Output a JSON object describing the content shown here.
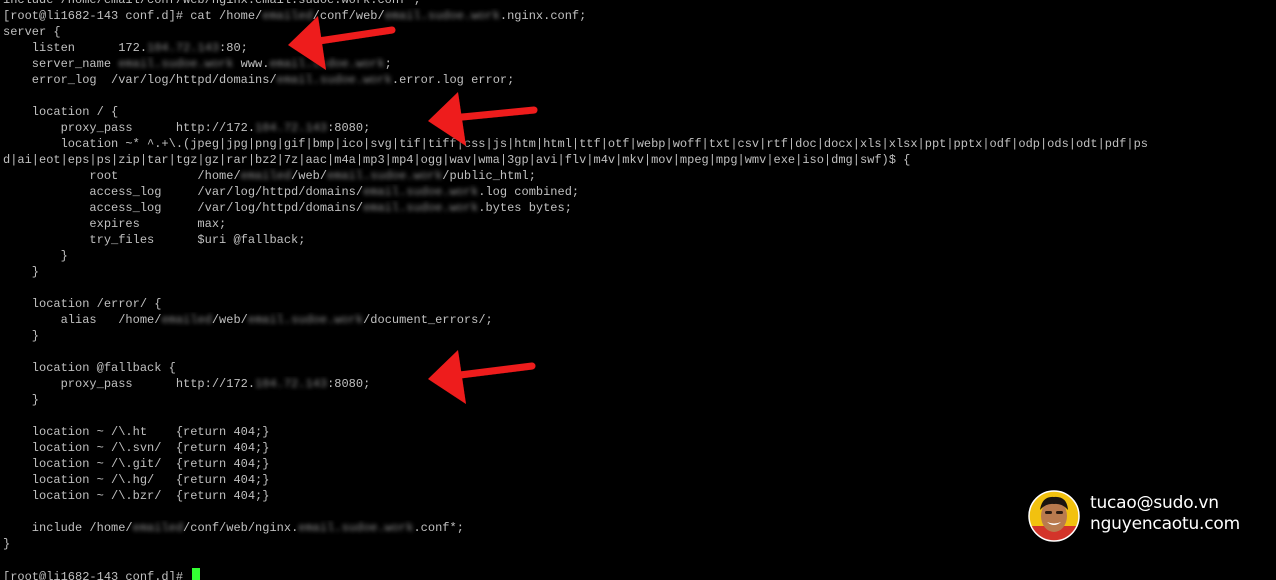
{
  "terminal": {
    "lines": [
      [
        {
          "t": "include /home/email/conf/web/nginx.email.sudoe.work.conf*;",
          "b": false
        }
      ],
      [
        {
          "t": "[root@li1682-143 conf.d]# cat /home/",
          "b": false
        },
        {
          "t": "emailed",
          "b": true
        },
        {
          "t": "/conf/web/",
          "b": false
        },
        {
          "t": "email.sudoe.work",
          "b": true
        },
        {
          "t": ".nginx.conf;",
          "b": false
        }
      ],
      [
        {
          "t": "server {",
          "b": false
        }
      ],
      [
        {
          "t": "    listen      172.",
          "b": false
        },
        {
          "t": "104.72.143",
          "b": true
        },
        {
          "t": ":80;",
          "b": false
        }
      ],
      [
        {
          "t": "    server_name ",
          "b": false
        },
        {
          "t": "email.sudoe.work",
          "b": true
        },
        {
          "t": " www.",
          "b": false
        },
        {
          "t": "email.sudoe.work",
          "b": true
        },
        {
          "t": ";",
          "b": false
        }
      ],
      [
        {
          "t": "    error_log  /var/log/httpd/domains/",
          "b": false
        },
        {
          "t": "email.sudoe.work",
          "b": true
        },
        {
          "t": ".error.log error;",
          "b": false
        }
      ],
      [
        {
          "t": "",
          "b": false
        }
      ],
      [
        {
          "t": "    location / {",
          "b": false
        }
      ],
      [
        {
          "t": "        proxy_pass      http://172.",
          "b": false
        },
        {
          "t": "104.72.143",
          "b": true
        },
        {
          "t": ":8080;",
          "b": false
        }
      ],
      [
        {
          "t": "        location ~* ^.+\\.(jpeg|jpg|png|gif|bmp|ico|svg|tif|tiff|css|js|htm|html|ttf|otf|webp|woff|txt|csv|rtf|doc|docx|xls|xlsx|ppt|pptx|odf|odp|ods|odt|pdf|ps",
          "b": false
        }
      ],
      [
        {
          "t": "d|ai|eot|eps|ps|zip|tar|tgz|gz|rar|bz2|7z|aac|m4a|mp3|mp4|ogg|wav|wma|3gp|avi|flv|m4v|mkv|mov|mpeg|mpg|wmv|exe|iso|dmg|swf)$ {",
          "b": false
        }
      ],
      [
        {
          "t": "            root           /home/",
          "b": false
        },
        {
          "t": "emailed",
          "b": true
        },
        {
          "t": "/web/",
          "b": false
        },
        {
          "t": "email.sudoe.work",
          "b": true
        },
        {
          "t": "/public_html;",
          "b": false
        }
      ],
      [
        {
          "t": "            access_log     /var/log/httpd/domains/",
          "b": false
        },
        {
          "t": "email.sudoe.work",
          "b": true
        },
        {
          "t": ".log combined;",
          "b": false
        }
      ],
      [
        {
          "t": "            access_log     /var/log/httpd/domains/",
          "b": false
        },
        {
          "t": "email.sudoe.work",
          "b": true
        },
        {
          "t": ".bytes bytes;",
          "b": false
        }
      ],
      [
        {
          "t": "            expires        max;",
          "b": false
        }
      ],
      [
        {
          "t": "            try_files      $uri @fallback;",
          "b": false
        }
      ],
      [
        {
          "t": "        }",
          "b": false
        }
      ],
      [
        {
          "t": "    }",
          "b": false
        }
      ],
      [
        {
          "t": "",
          "b": false
        }
      ],
      [
        {
          "t": "    location /error/ {",
          "b": false
        }
      ],
      [
        {
          "t": "        alias   /home/",
          "b": false
        },
        {
          "t": "emailed",
          "b": true
        },
        {
          "t": "/web/",
          "b": false
        },
        {
          "t": "email.sudoe.work",
          "b": true
        },
        {
          "t": "/document_errors/;",
          "b": false
        }
      ],
      [
        {
          "t": "    }",
          "b": false
        }
      ],
      [
        {
          "t": "",
          "b": false
        }
      ],
      [
        {
          "t": "    location @fallback {",
          "b": false
        }
      ],
      [
        {
          "t": "        proxy_pass      http://172.",
          "b": false
        },
        {
          "t": "104.72.143",
          "b": true
        },
        {
          "t": ":8080;",
          "b": false
        }
      ],
      [
        {
          "t": "    }",
          "b": false
        }
      ],
      [
        {
          "t": "",
          "b": false
        }
      ],
      [
        {
          "t": "    location ~ /\\.ht    {return 404;}",
          "b": false
        }
      ],
      [
        {
          "t": "    location ~ /\\.svn/  {return 404;}",
          "b": false
        }
      ],
      [
        {
          "t": "    location ~ /\\.git/  {return 404;}",
          "b": false
        }
      ],
      [
        {
          "t": "    location ~ /\\.hg/   {return 404;}",
          "b": false
        }
      ],
      [
        {
          "t": "    location ~ /\\.bzr/  {return 404;}",
          "b": false
        }
      ],
      [
        {
          "t": "",
          "b": false
        }
      ],
      [
        {
          "t": "    include /home/",
          "b": false
        },
        {
          "t": "emailed",
          "b": true
        },
        {
          "t": "/conf/web/nginx.",
          "b": false
        },
        {
          "t": "email.sudoe.work",
          "b": true
        },
        {
          "t": ".conf*;",
          "b": false
        }
      ],
      [
        {
          "t": "}",
          "b": false
        }
      ],
      [
        {
          "t": "",
          "b": false
        }
      ],
      [
        {
          "t": "[root@li1682-143 conf.d]# ",
          "b": false
        }
      ]
    ],
    "text_color": "#c0c0c0",
    "background": "#000000",
    "cursor_color": "#33ff33"
  },
  "annotations": {
    "arrow_color": "#ee1c1c",
    "arrow_count": 3
  },
  "watermark": {
    "line1": "tucao@sudo.vn",
    "line2": "nguyencaotu.com"
  }
}
